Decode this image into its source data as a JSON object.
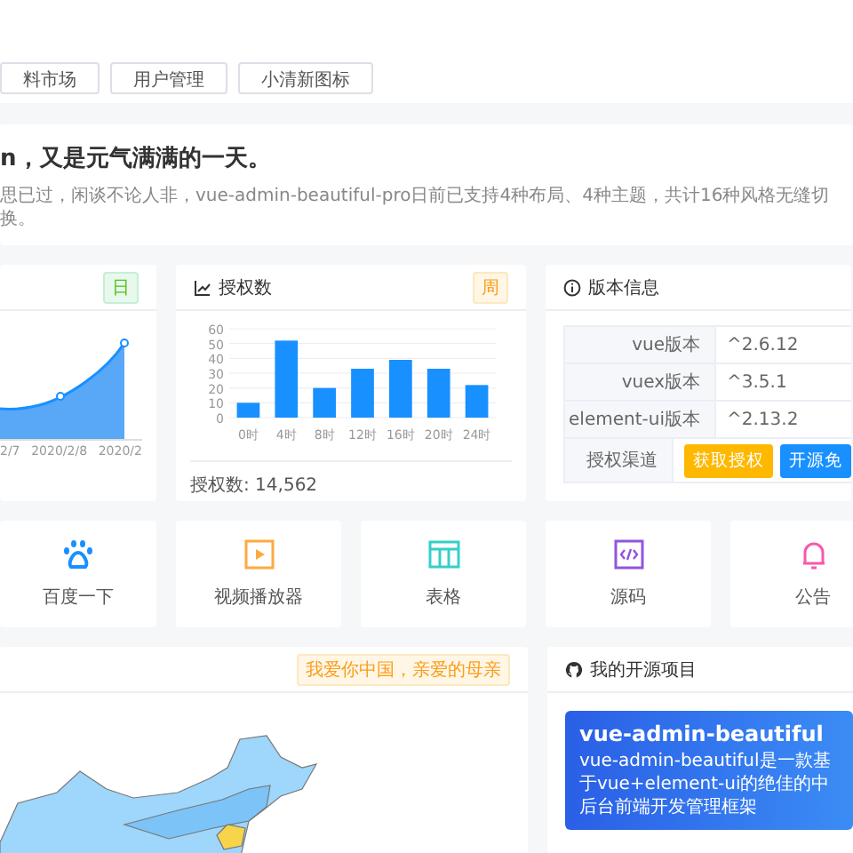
{
  "tabs": [
    {
      "label": "料市场"
    },
    {
      "label": "用户管理"
    },
    {
      "label": "小清新图标"
    }
  ],
  "welcome": {
    "title": "n，又是元气满满的一天。",
    "description": "思已过，闲谈不论人非，vue-admin-beautiful-pro日前已支持4种布局、4种主题，共计16种风格无缝切换。"
  },
  "trend_card": {
    "tag": "日",
    "x_labels": [
      "2/7",
      "2020/2/8",
      "2020/2"
    ]
  },
  "auth_card": {
    "title": "授权数",
    "tag": "周",
    "footer": "授权数: 14,562",
    "chart_data": {
      "type": "bar",
      "categories": [
        "0时",
        "4时",
        "8时",
        "12时",
        "16时",
        "20时",
        "24时"
      ],
      "values": [
        10,
        52,
        20,
        33,
        39,
        33,
        22
      ],
      "ylim": [
        0,
        60
      ],
      "grid": true,
      "yticks": [
        0,
        10,
        20,
        30,
        40,
        50,
        60
      ]
    }
  },
  "version_card": {
    "title": "版本信息",
    "rows": [
      {
        "label": "vue版本",
        "kind": "text",
        "value": "^2.6.12"
      },
      {
        "label": "vuex版本",
        "kind": "text",
        "value": "^3.5.1"
      },
      {
        "label": "element-ui版本",
        "kind": "text",
        "value": "^2.13.2"
      },
      {
        "label": "授权渠道",
        "kind": "buttons",
        "buttons": [
          "获取授权",
          "开源免"
        ]
      }
    ]
  },
  "shortcuts": [
    {
      "label": "百度一下",
      "color": "#1890ff"
    },
    {
      "label": "视频播放器",
      "color": "#ffa940"
    },
    {
      "label": "表格",
      "color": "#36cfc9"
    },
    {
      "label": "源码",
      "color": "#9254de"
    },
    {
      "label": "公告",
      "color": "#f759ab"
    }
  ],
  "map_card": {
    "tag": "我爱你中国，亲爱的母亲"
  },
  "project_card": {
    "title": "我的开源项目",
    "banner_title": "vue-admin-beautiful",
    "banner_text": "vue-admin-beautiful是一款基于vue+element-ui的绝佳的中后台前端开发管理框架"
  }
}
